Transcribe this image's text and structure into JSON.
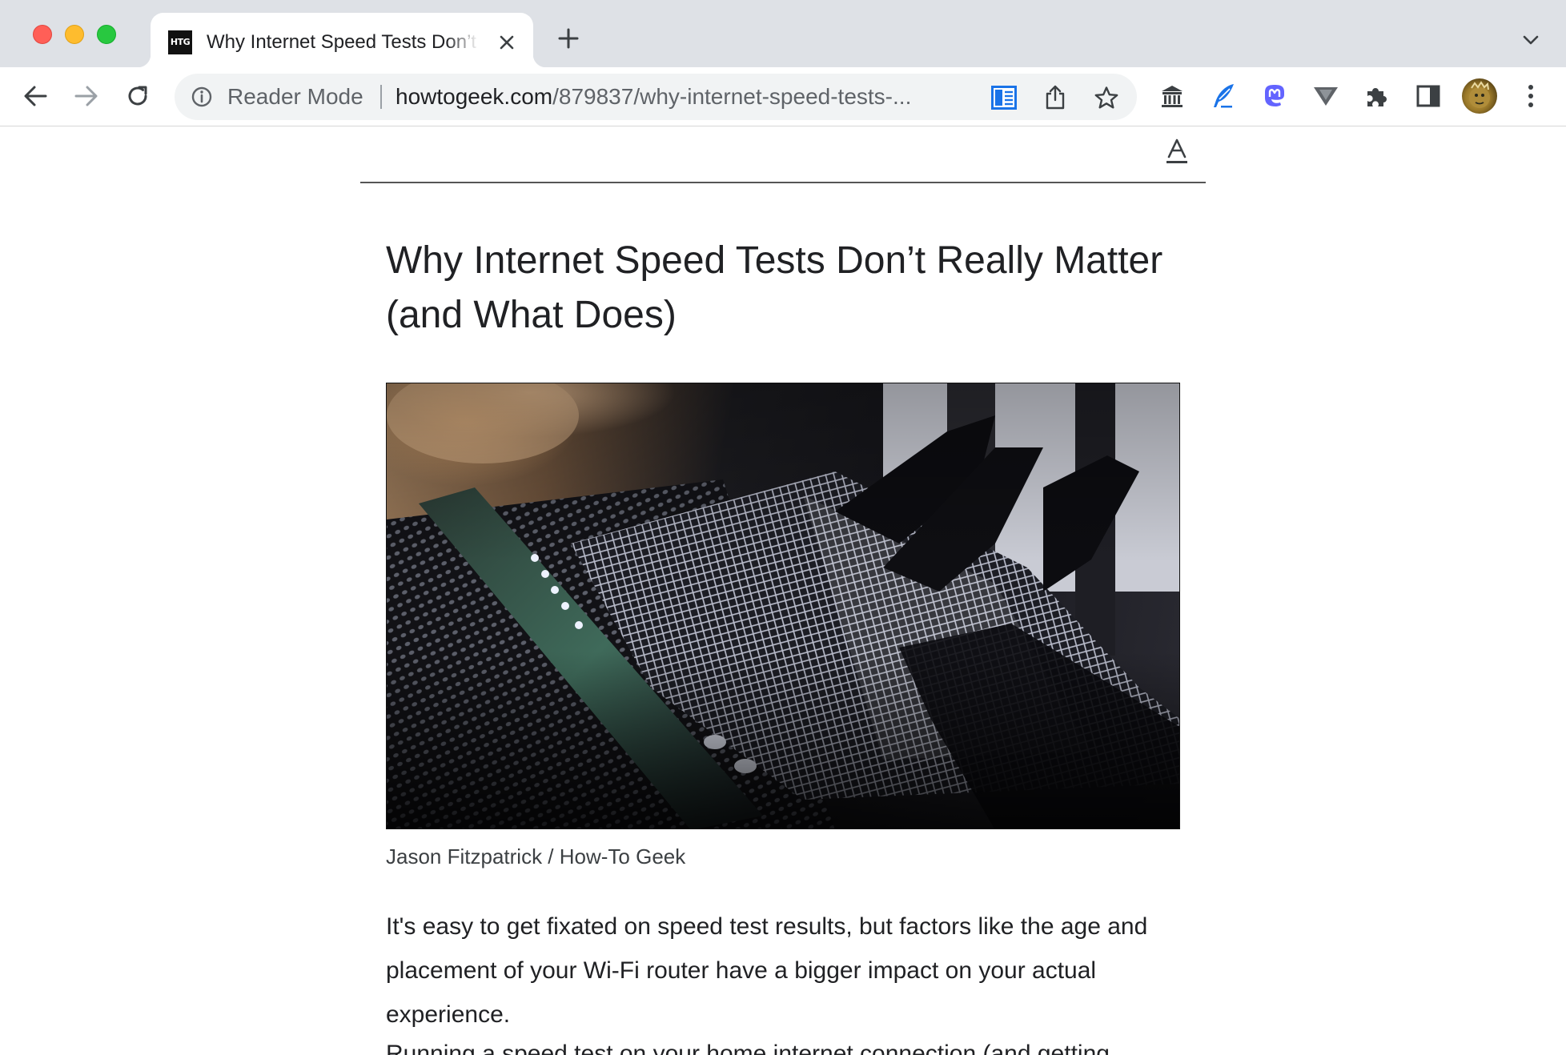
{
  "tab": {
    "favicon_text": "HTG",
    "title": "Why Internet Speed Tests Don’t Really Matter (and What Does)"
  },
  "omnibox": {
    "chip_label": "Reader Mode",
    "url_host": "howtogeek.com",
    "url_path": "/879837/why-internet-speed-tests-..."
  },
  "icons": {
    "close": "close-icon",
    "new_tab": "plus-icon",
    "tab_list": "chevron-down-icon",
    "back": "arrow-left-icon",
    "forward": "arrow-right-icon",
    "reload": "reload-icon",
    "site_info": "info-icon",
    "reader_mode": "reader-mode-icon",
    "share": "share-icon",
    "bookmark": "star-icon",
    "extensions": [
      "museum-icon",
      "feather-pen-icon",
      "mastodon-icon",
      "triangle-shield-icon",
      "puzzle-icon"
    ],
    "side_panel": "side-panel-icon",
    "menu": "kebab-menu-icon",
    "reader_font": "font-settings-icon"
  },
  "colors": {
    "tabstrip_bg": "#dee1e6",
    "reader_icon_blue": "#1a73e8",
    "mastodon_purple": "#6364ff"
  },
  "article": {
    "title": "Why Internet Speed Tests Don’t Really Matter (and What Does)",
    "image_caption": "Jason Fitzpatrick / How-To Geek",
    "paragraph_1": "It's easy to get fixated on speed test results, but factors like the age and placement of your Wi-Fi router have a bigger impact on your actual experience.",
    "paragraph_2_partial": "Running a speed test on your home internet connection (and getting"
  }
}
